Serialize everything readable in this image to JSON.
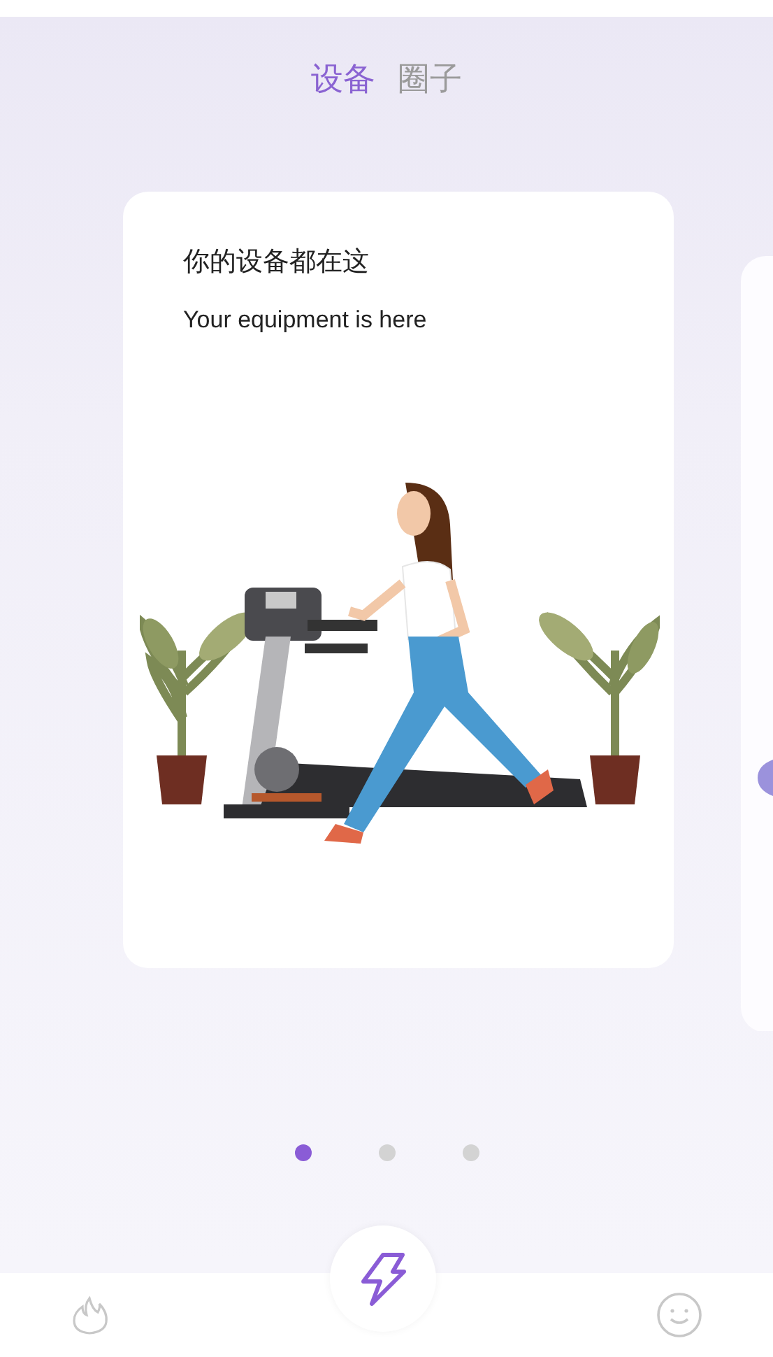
{
  "tabs": [
    {
      "label": "设备",
      "selected": true
    },
    {
      "label": "圈子",
      "selected": false
    }
  ],
  "card": {
    "title": "你的设备都在这",
    "subtitle": "Your equipment is here"
  },
  "pager_dots": [
    {
      "selected": true
    },
    {
      "selected": false
    },
    {
      "selected": false
    }
  ],
  "bottom_nav": [
    {
      "kind": "flame",
      "selected": false
    },
    {
      "kind": "bolt",
      "selected": true
    },
    {
      "kind": "smile",
      "selected": false
    }
  ]
}
